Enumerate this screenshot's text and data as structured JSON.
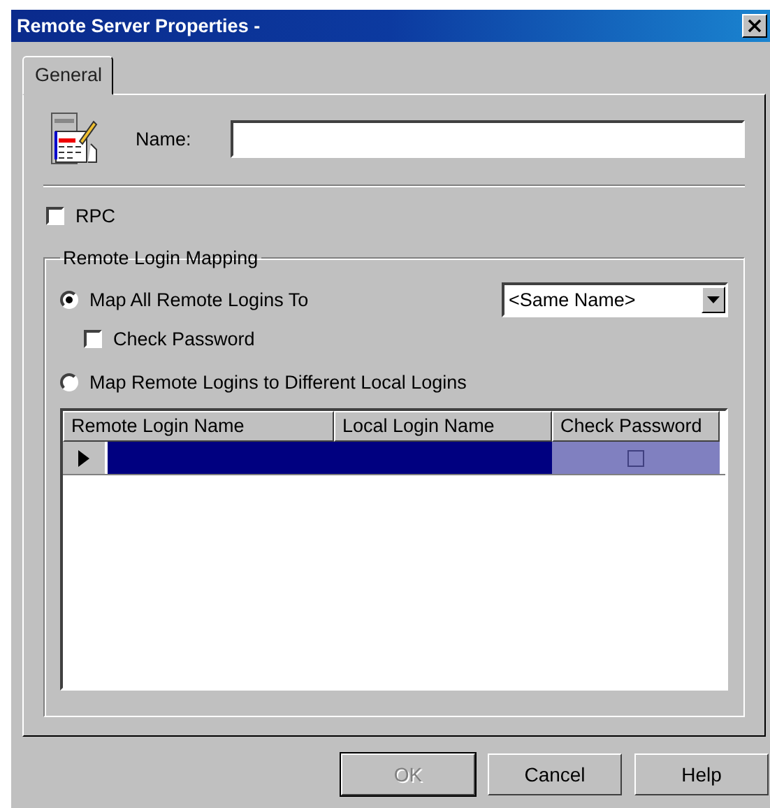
{
  "window": {
    "title": "Remote Server Properties -"
  },
  "tabs": [
    {
      "label": "General",
      "selected": true
    }
  ],
  "name_field": {
    "label": "Name:"
  },
  "rpc": {
    "label": "RPC",
    "checked": false
  },
  "group": {
    "title": "Remote Login Mapping"
  },
  "options": [
    {
      "label": "Map All Remote Logins To",
      "selected": true
    },
    {
      "label": "Map Remote Logins to Different Local Logins",
      "selected": false
    }
  ],
  "mapping_dropdown": {
    "value": "<Same Name>"
  },
  "check_password": {
    "label": "Check Password",
    "checked": false
  },
  "table": {
    "columns": [
      "Remote Login Name",
      "Local Login Name",
      "Check Password"
    ],
    "rows": [
      {
        "selected": true,
        "check_password": false
      }
    ]
  },
  "buttons": [
    {
      "label": "OK",
      "disabled": true
    },
    {
      "label": "Cancel",
      "disabled": false
    },
    {
      "label": "Help",
      "disabled": false
    }
  ]
}
